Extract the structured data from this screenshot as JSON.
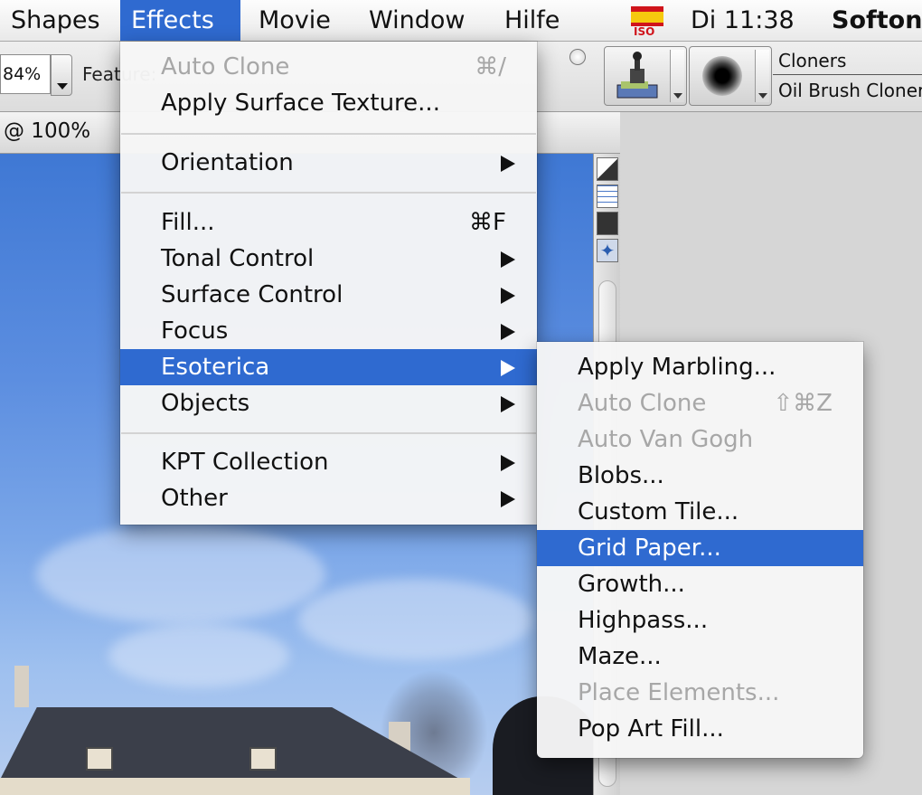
{
  "menubar": {
    "items": [
      "Shapes",
      "Effects",
      "Movie",
      "Window",
      "Hilfe"
    ],
    "active_item": "Effects",
    "flag_text": "ISO",
    "clock": "Di 11:38",
    "user": "Softon"
  },
  "propbar": {
    "zoom_value": "84%",
    "feature_label": "Feature:",
    "brush_category": "Cloners",
    "brush_variant": "Oil Brush Cloner"
  },
  "document": {
    "title": "@ 100%"
  },
  "effects_menu": {
    "items": [
      {
        "label": "Auto Clone",
        "shortcut": "⌘/",
        "disabled": true
      },
      {
        "label": "Apply Surface Texture...",
        "shortcut": ""
      },
      {
        "label": "Orientation",
        "submenu": true
      },
      {
        "label": "Fill...",
        "shortcut": "⌘F"
      },
      {
        "label": "Tonal Control",
        "submenu": true
      },
      {
        "label": "Surface Control",
        "submenu": true
      },
      {
        "label": "Focus",
        "submenu": true
      },
      {
        "label": "Esoterica",
        "submenu": true,
        "highlighted": true
      },
      {
        "label": "Objects",
        "submenu": true
      },
      {
        "label": "KPT Collection",
        "submenu": true
      },
      {
        "label": "Other",
        "submenu": true
      }
    ]
  },
  "esoterica_menu": {
    "items": [
      {
        "label": "Apply Marbling...",
        "shortcut": ""
      },
      {
        "label": "Auto Clone",
        "shortcut": "⇧⌘Z",
        "disabled": true
      },
      {
        "label": "Auto Van Gogh",
        "disabled": true
      },
      {
        "label": "Blobs..."
      },
      {
        "label": "Custom Tile..."
      },
      {
        "label": "Grid Paper...",
        "highlighted": true
      },
      {
        "label": "Growth..."
      },
      {
        "label": "Highpass..."
      },
      {
        "label": "Maze..."
      },
      {
        "label": "Place Elements...",
        "disabled": true
      },
      {
        "label": "Pop Art Fill..."
      }
    ]
  },
  "colors": {
    "highlight": "#2f6ad0",
    "disabled_text": "#a7a7a7"
  }
}
